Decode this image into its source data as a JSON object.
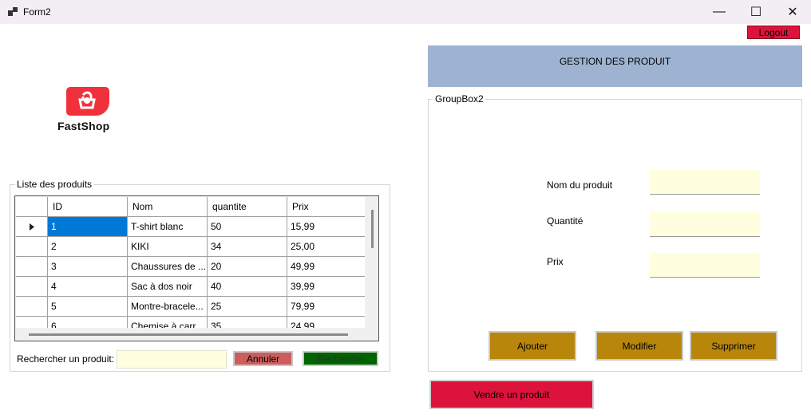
{
  "window": {
    "title": "Form2",
    "minimize_glyph": "—",
    "maximize_glyph": "☐",
    "close_glyph": "✕"
  },
  "logout_label": "Logout",
  "header": {
    "title": "GESTION DES PRODUIT"
  },
  "logo": {
    "text": "FastShop",
    "brand_color": "#f0313c"
  },
  "products_group": {
    "legend": "Liste des produits",
    "columns": [
      "ID",
      "Nom",
      "quantite",
      "Prix"
    ],
    "rows": [
      {
        "id": "1",
        "nom": "T-shirt blanc",
        "quantite": "50",
        "prix": "15,99",
        "selected": true
      },
      {
        "id": "2",
        "nom": "KIKI",
        "quantite": "34",
        "prix": "25,00"
      },
      {
        "id": "3",
        "nom": "Chaussures de ...",
        "quantite": "20",
        "prix": "49,99"
      },
      {
        "id": "4",
        "nom": "Sac à dos noir",
        "quantite": "40",
        "prix": "39,99"
      },
      {
        "id": "5",
        "nom": "Montre-bracele...",
        "quantite": "25",
        "prix": "79,99"
      },
      {
        "id": "6",
        "nom": "Chemise à carr",
        "quantite": "35",
        "prix": "24,99"
      }
    ],
    "search_label": "Rechercher un produit:",
    "search_value": "",
    "annuler_label": "Annuler",
    "recherche_label": "Recherche"
  },
  "form_group": {
    "legend": "GroupBox2",
    "nom_label": "Nom du produit",
    "quantite_label": "Quantité",
    "prix_label": "Prix",
    "nom_value": "",
    "quantite_value": "",
    "prix_value": "",
    "ajouter_label": "Ajouter",
    "modifier_label": "Modifier",
    "supprimer_label": "Supprimer"
  },
  "vendre_label": "Vendre un produit",
  "colors": {
    "header_bg": "#9db3d1",
    "gold": "#b8860b",
    "crimson": "#dc143c",
    "indian_red": "#cd5c5c",
    "dark_green": "#006400",
    "input_bg": "#ffffe0",
    "selection": "#0078d7"
  }
}
